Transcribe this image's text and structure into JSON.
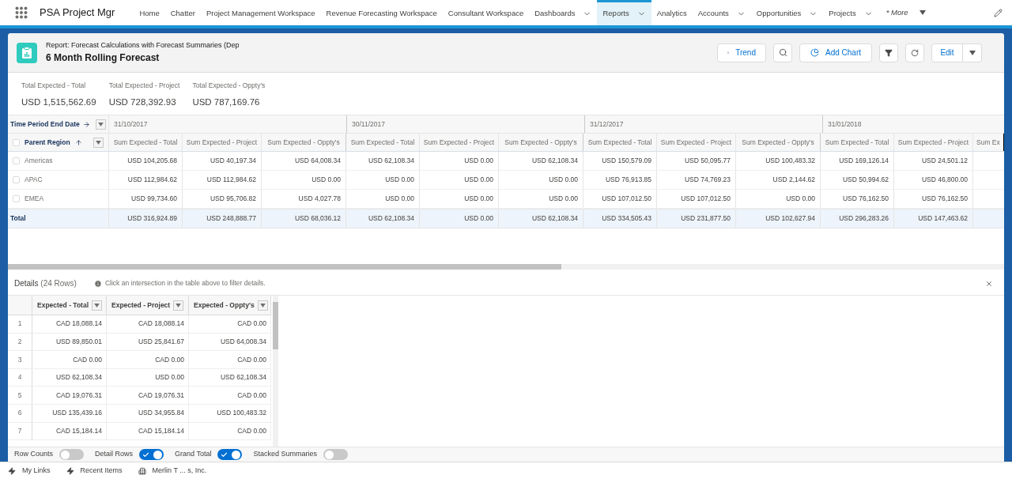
{
  "app": {
    "name": "PSA Project Mgr"
  },
  "nav": {
    "items": [
      {
        "label": "Home",
        "selected": false,
        "menu": false
      },
      {
        "label": "Chatter",
        "selected": false,
        "menu": false
      },
      {
        "label": "Project Management Workspace",
        "selected": false,
        "menu": false
      },
      {
        "label": "Revenue Forecasting Workspace",
        "selected": false,
        "menu": false
      },
      {
        "label": "Consultant Workspace",
        "selected": false,
        "menu": false
      },
      {
        "label": "Dashboards",
        "selected": false,
        "menu": true
      },
      {
        "label": "Reports",
        "selected": true,
        "menu": true
      },
      {
        "label": "Analytics",
        "selected": false,
        "menu": false
      },
      {
        "label": "Accounts",
        "selected": false,
        "menu": true
      },
      {
        "label": "Opportunities",
        "selected": false,
        "menu": true
      },
      {
        "label": "Projects",
        "selected": false,
        "menu": true
      }
    ],
    "more": "* More"
  },
  "report": {
    "type_line": "Report: Forecast Calculations with Forecast Summaries (Dep",
    "title": "6 Month Rolling Forecast",
    "buttons": [
      {
        "kind": "trend",
        "label": "Trend"
      },
      {
        "kind": "search"
      },
      {
        "kind": "chart",
        "label": "Add Chart"
      },
      {
        "kind": "filter"
      },
      {
        "kind": "refresh"
      },
      {
        "kind": "edit",
        "label": "Edit"
      }
    ]
  },
  "totals": [
    {
      "label": "Total Expected - Total",
      "value": "USD 1,515,562.69"
    },
    {
      "label": "Total Expected - Project",
      "value": "USD 728,392.93"
    },
    {
      "label": "Total Expected - Oppty's",
      "value": "USD 787,169.76"
    }
  ],
  "matrix": {
    "column_group": "Time Period End Date",
    "row_group": "Parent Region",
    "select_all_checked": false,
    "periods": [
      "31/10/2017",
      "30/11/2017",
      "31/12/2017",
      "31/01/2018"
    ],
    "columns": [
      "Sum Expected - Total",
      "Sum Expected - Project",
      "Sum Expected - Oppty's",
      "Sum Expected - Total",
      "Sum Expected - Project",
      "Sum Expected - Oppty's",
      "Sum Expected - Total",
      "Sum Expected - Project",
      "Sum Expected - Oppty's",
      "Sum Expected - Total",
      "Sum Expected - Project",
      "Sum Ex"
    ],
    "rows": [
      {
        "label": "Americas",
        "checked": false,
        "cells": [
          "USD 104,205.68",
          "USD 40,197.34",
          "USD 64,008.34",
          "USD 62,108.34",
          "USD 0.00",
          "USD 62,108.34",
          "USD 150,579.09",
          "USD 50,095.77",
          "USD 100,483.32",
          "USD 169,126.14",
          "USD 24,501.12"
        ]
      },
      {
        "label": "APAC",
        "checked": false,
        "cells": [
          "USD 112,984.62",
          "USD 112,984.62",
          "USD 0.00",
          "USD 0.00",
          "USD 0.00",
          "USD 0.00",
          "USD 76,913.85",
          "USD 74,769.23",
          "USD 2,144.62",
          "USD 50,994.62",
          "USD 46,800.00"
        ]
      },
      {
        "label": "EMEA",
        "checked": false,
        "cells": [
          "USD 99,734.60",
          "USD 95,706.82",
          "USD 4,027.78",
          "USD 0.00",
          "USD 0.00",
          "USD 0.00",
          "USD 107,012.50",
          "USD 107,012.50",
          "USD 0.00",
          "USD 76,162.50",
          "USD 76,162.50"
        ]
      }
    ],
    "total": {
      "label": "Total",
      "cells": [
        "USD 316,924.89",
        "USD 248,888.77",
        "USD 68,036.12",
        "USD 62,108.34",
        "USD 0.00",
        "USD 62,108.34",
        "USD 334,505.43",
        "USD 231,877.50",
        "USD 102,627.94",
        "USD 296,283.26",
        "USD 147,463.62"
      ]
    }
  },
  "details": {
    "title": "Details",
    "count": "(24 Rows)",
    "hint": "Click an intersection in the table above to filter details.",
    "columns": [
      "Expected - Total",
      "Expected - Project",
      "Expected - Oppty's"
    ],
    "rows": [
      {
        "number": "1",
        "cells": [
          "CAD 18,088.14",
          "CAD 18,088.14",
          "CAD 0.00"
        ]
      },
      {
        "number": "2",
        "cells": [
          "USD 89,850.01",
          "USD 25,841.67",
          "USD 64,008.34"
        ]
      },
      {
        "number": "3",
        "cells": [
          "CAD 0.00",
          "CAD 0.00",
          "CAD 0.00"
        ]
      },
      {
        "number": "4",
        "cells": [
          "USD 62,108.34",
          "USD 0.00",
          "USD 62,108.34"
        ]
      },
      {
        "number": "5",
        "cells": [
          "CAD 19,076.31",
          "CAD 19,076.31",
          "CAD 0.00"
        ]
      },
      {
        "number": "6",
        "cells": [
          "USD 135,439.16",
          "USD 34,955.84",
          "USD 100,483.32"
        ]
      },
      {
        "number": "7",
        "cells": [
          "CAD 15,184.14",
          "CAD 15,184.14",
          "CAD 0.00"
        ]
      }
    ]
  },
  "toggles": [
    {
      "label": "Row Counts",
      "on": false
    },
    {
      "label": "Detail Rows",
      "on": true
    },
    {
      "label": "Grand Total",
      "on": true
    },
    {
      "label": "Stacked Summaries",
      "on": false
    }
  ],
  "utility_bar": [
    {
      "kind": "bolt",
      "label": "My Links"
    },
    {
      "kind": "bolt",
      "label": "Recent Items"
    },
    {
      "kind": "building",
      "label": "Merlin T ... s, Inc."
    }
  ]
}
